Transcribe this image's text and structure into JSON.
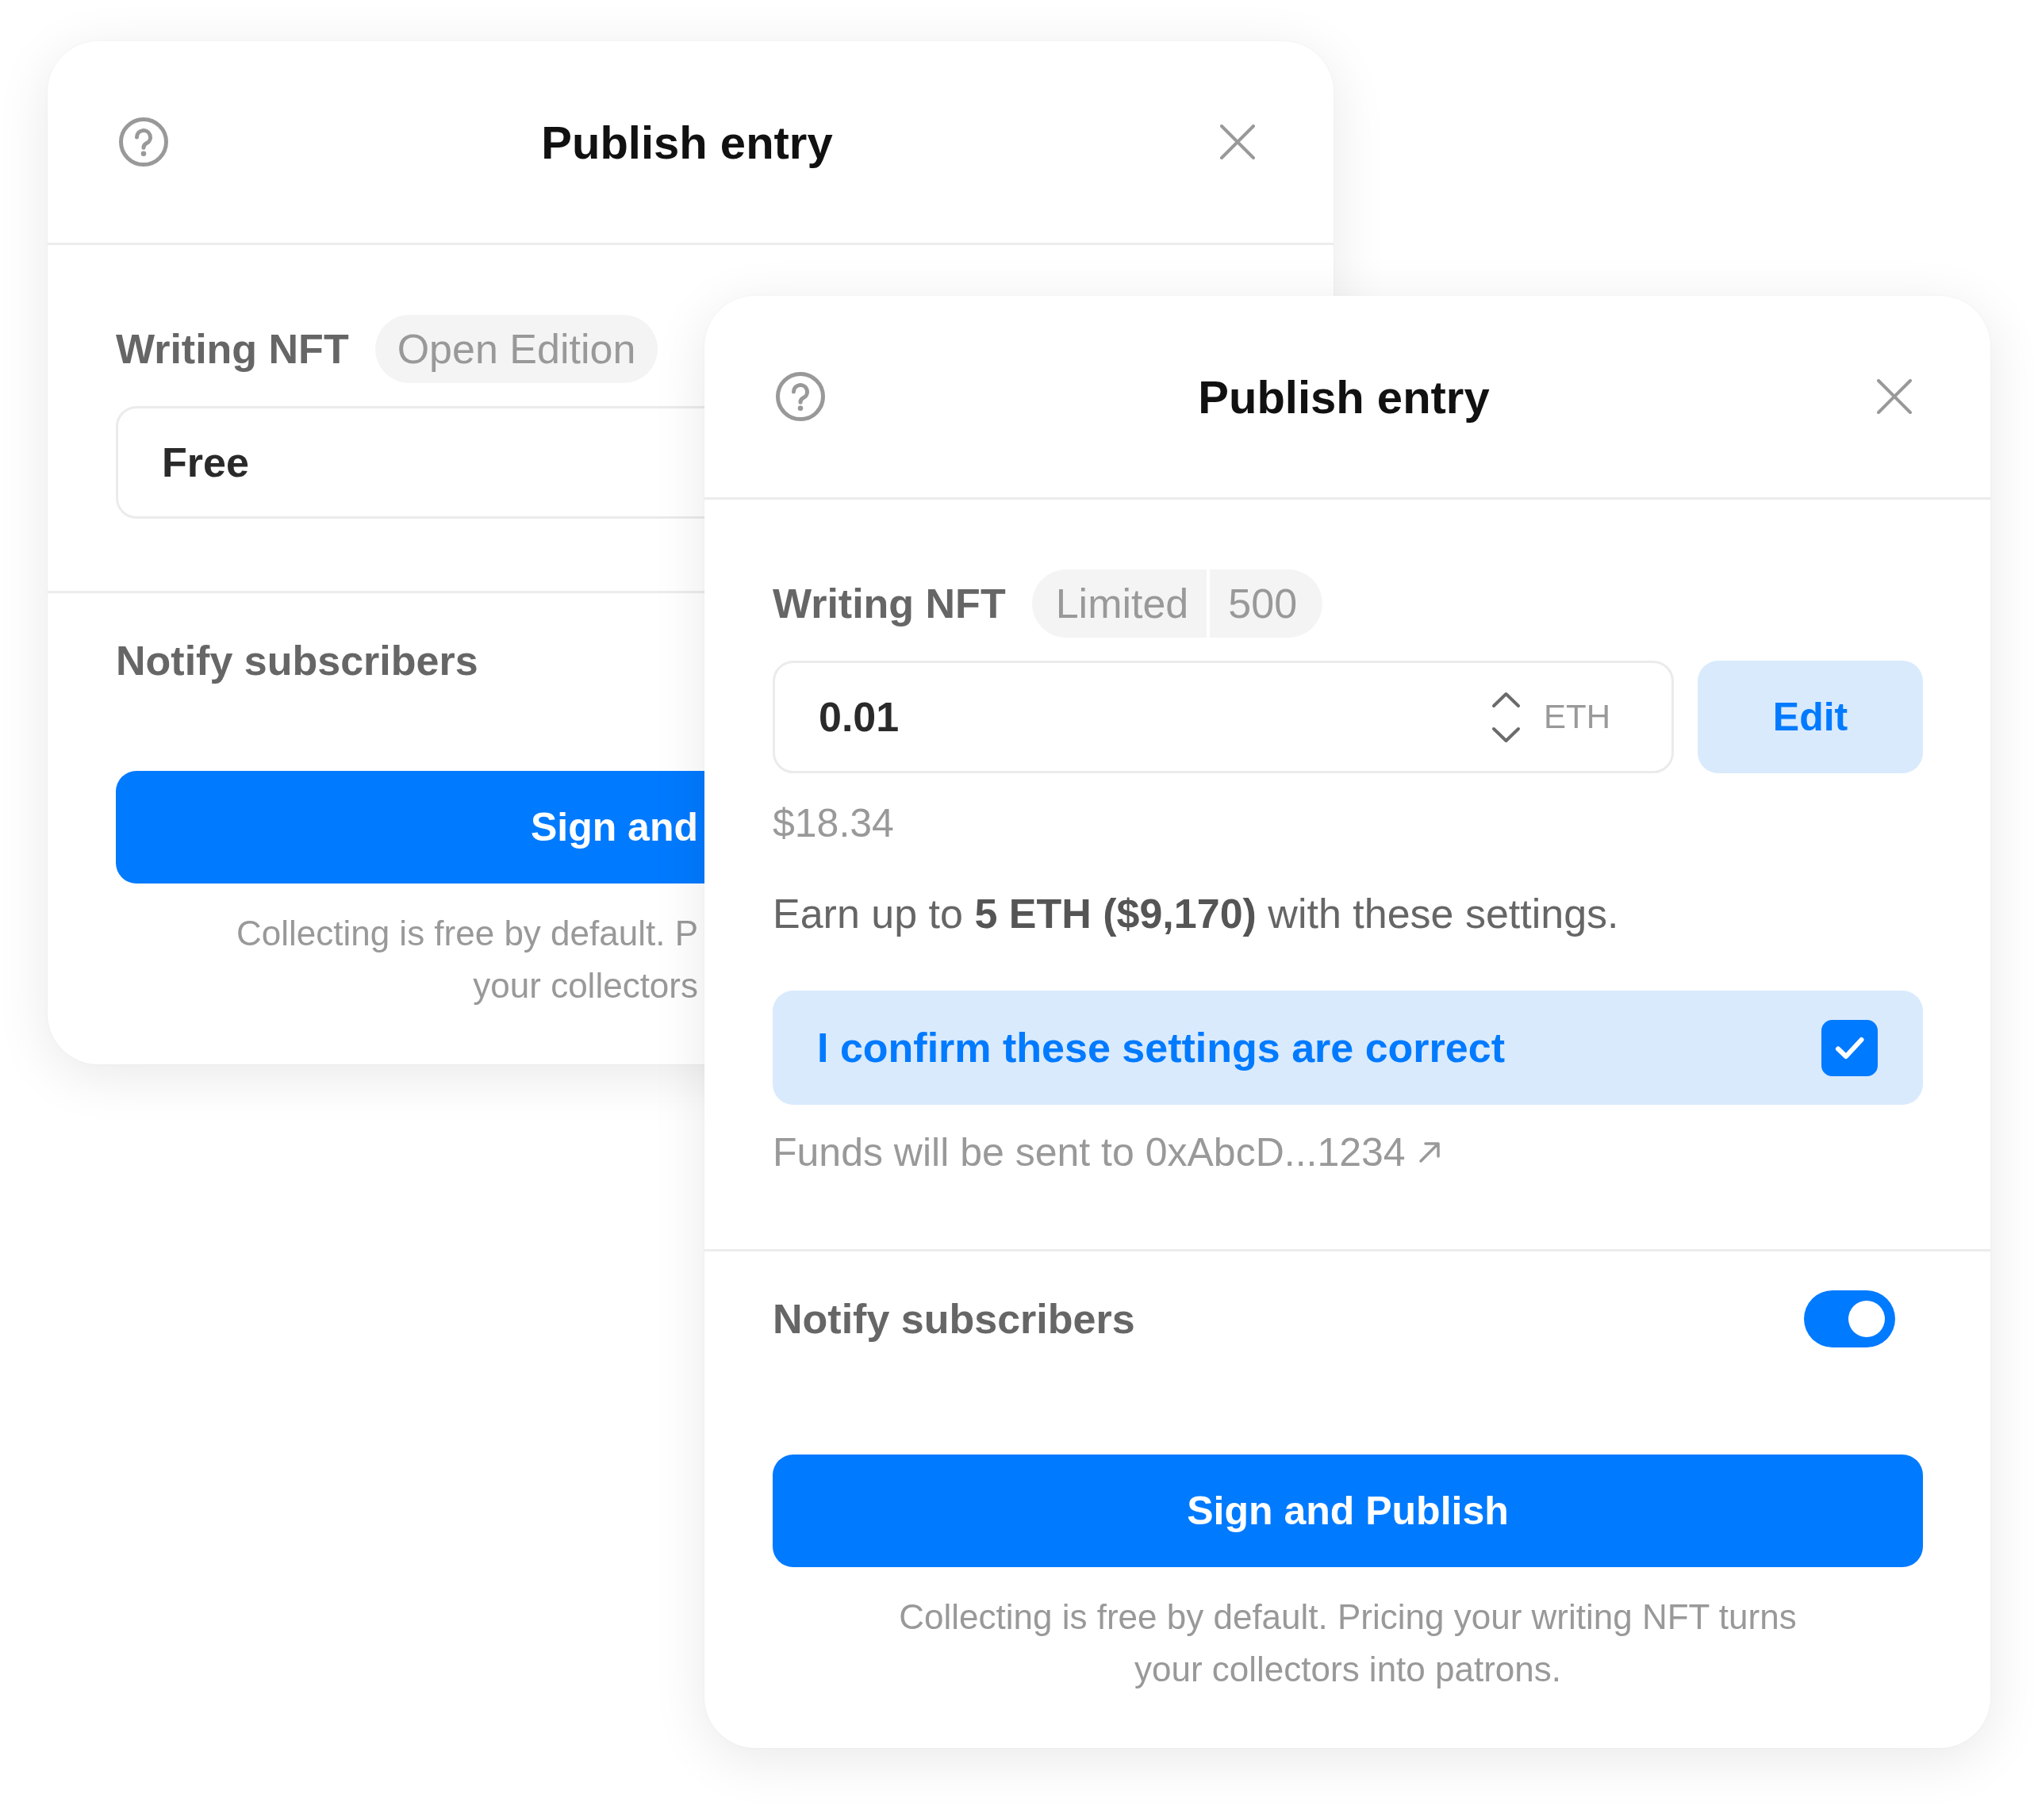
{
  "dialogs": [
    {
      "title": "Publish entry",
      "nft": {
        "label": "Writing NFT",
        "badge": [
          "Open Edition"
        ]
      },
      "price": {
        "value": "Free"
      },
      "notify": {
        "label": "Notify subscribers"
      },
      "publish_button": "Sign and",
      "footer_lines": [
        "Collecting is free by default. P",
        "your collectors"
      ]
    },
    {
      "title": "Publish entry",
      "nft": {
        "label": "Writing NFT",
        "badge": [
          "Limited",
          "500"
        ]
      },
      "price": {
        "value": "0.01",
        "unit": "ETH",
        "edit_button": "Edit"
      },
      "conversion": "$18.34",
      "earnings": "Earn up to **5 ETH ($9,170)** with these settings.",
      "confirm": {
        "label": "I confirm these settings are correct",
        "checked": true
      },
      "funds": "Funds will be sent to 0xAbcD...1234",
      "notify": {
        "label": "Notify subscribers",
        "on": true
      },
      "publish_button": "Sign and Publish",
      "footer_lines": [
        "Collecting is free by default. Pricing your writing NFT turns",
        "your collectors into patrons."
      ]
    }
  ]
}
